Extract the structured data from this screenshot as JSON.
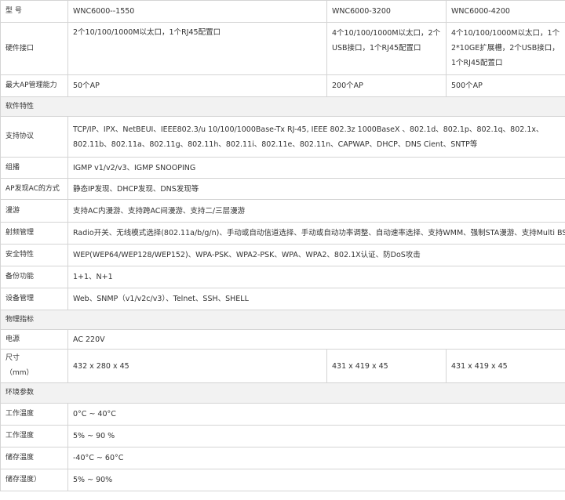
{
  "header": {
    "label": "型 号",
    "models": [
      "WNC6000--1550",
      "WNC6000-3200",
      "WNC6000-4200"
    ]
  },
  "hardware": {
    "label": "硬件接口",
    "values": [
      "2个10/100/1000M以太口，1个RJ45配置口",
      "4个10/100/1000M以太口，2个USB接口，1个RJ45配置口",
      "4个10/100/1000M以太口，1个2*10GE扩展槽，2个USB接口，1个RJ45配置口"
    ]
  },
  "max_ap": {
    "label": "最大AP管理能力",
    "values": [
      "50个AP",
      "200个AP",
      "500个AP"
    ]
  },
  "software_section": "软件特性",
  "rows_software": [
    {
      "label": "支持协议",
      "value": "TCP/IP、IPX、NetBEUI、IEEE802.3/u 10/100/1000Base-Tx RJ-45, IEEE 802.3z 1000BaseX 、802.1d、802.1p、802.1q、802.1x、802.11b、802.11a、802.11g、802.11h、802.11i、802.11e、802.11n、CAPWAP、DHCP、DNS Cient、SNTP等"
    },
    {
      "label": "组播",
      "value": "IGMP v1/v2/v3、IGMP SNOOPING"
    },
    {
      "label": "AP发现AC的方式",
      "value": "静态IP发现、DHCP发现、DNS发现等"
    },
    {
      "label": "漫游",
      "value": "支持AC内漫游、支持跨AC间漫游、支持二/三层漫游"
    },
    {
      "label": "射频管理",
      "value": "Radio开关、无线模式选择(802.11a/b/g/n)、手动或自动信道选择、手动或自动功率调整、自动速率选择、支持WMM、强制STA漫游、支持Multi BSSID"
    },
    {
      "label": "安全特性",
      "value": "WEP(WEP64/WEP128/WEP152)、WPA-PSK、WPA2-PSK、WPA、WPA2、802.1X认证、防DoS攻击"
    },
    {
      "label": "备份功能",
      "value": "1+1、N+1"
    },
    {
      "label": "设备管理",
      "value": "Web、SNMP（v1/v2c/v3）、Telnet、SSH、SHELL"
    }
  ],
  "physical_section": "物理指标",
  "power": {
    "label": "电源",
    "value": "AC  220V"
  },
  "size": {
    "label_line1": "尺寸",
    "label_line2": "（mm）",
    "values": [
      "432 x 280 x 45",
      "431 x 419 x 45",
      "431 x 419 x 45"
    ]
  },
  "env_section": "环境参数",
  "rows_env": [
    {
      "label": "工作温度",
      "value": "0°C ~ 40°C"
    },
    {
      "label": "工作湿度",
      "value": "5% ~ 90 %"
    },
    {
      "label": "储存温度",
      "value": "-40°C ~ 60°C"
    },
    {
      "label": "储存湿度）",
      "value": "5% ~ 90%"
    }
  ]
}
